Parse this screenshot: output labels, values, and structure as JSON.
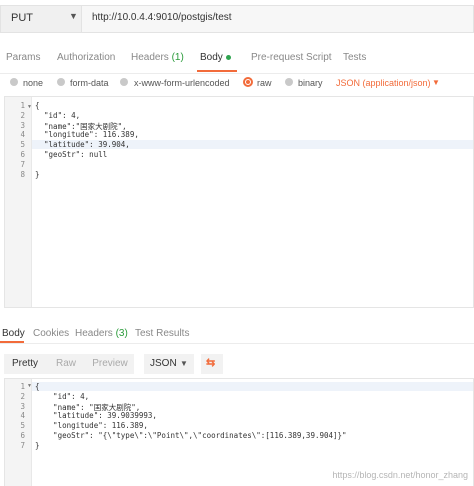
{
  "request": {
    "method": "PUT",
    "url": "http://10.0.4.4:9010/postgis/test"
  },
  "request_tabs": {
    "params": "Params",
    "authorization": "Authorization",
    "headers": "Headers",
    "headers_count": "(1)",
    "body": "Body",
    "prerequest": "Pre-request Script",
    "tests": "Tests"
  },
  "body_types": {
    "none": "none",
    "form_data": "form-data",
    "urlencoded": "x-www-form-urlencoded",
    "raw": "raw",
    "binary": "binary",
    "selected": "raw",
    "content_type": "JSON (application/json)"
  },
  "request_body": {
    "line_numbers": [
      "1",
      "2",
      "3",
      "4",
      "5",
      "6",
      "7",
      "8"
    ],
    "lines": [
      "{",
      "  \"id\": 4,",
      "  \"name\":\"国家大剧院\",",
      "  \"longitude\": 116.389,",
      "  \"latitude\": 39.904,",
      "  \"geoStr\": null",
      "",
      "}"
    ],
    "highlighted_line": 5
  },
  "response_tabs": {
    "body": "Body",
    "cookies": "Cookies",
    "headers": "Headers",
    "headers_count": "(3)",
    "test_results": "Test Results"
  },
  "response_toolbar": {
    "pretty": "Pretty",
    "raw": "Raw",
    "preview": "Preview",
    "format": "JSON"
  },
  "response_body": {
    "line_numbers": [
      "1",
      "2",
      "3",
      "4",
      "5",
      "6",
      "7"
    ],
    "lines": [
      "{",
      "    \"id\": 4,",
      "    \"name\": \"国家大剧院\",",
      "    \"latitude\": 39.9039993,",
      "    \"longitude\": 116.389,",
      "    \"geoStr\": \"{\\\"type\\\":\\\"Point\\\",\\\"coordinates\\\":[116.389,39.904]}\"",
      "}"
    ],
    "highlighted_line": 1
  },
  "watermark": "https://blog.csdn.net/honor_zhang",
  "colors": {
    "accent": "#f26b3a",
    "count_green": "#2a9b3a",
    "body_dot": "#2ea44f"
  }
}
